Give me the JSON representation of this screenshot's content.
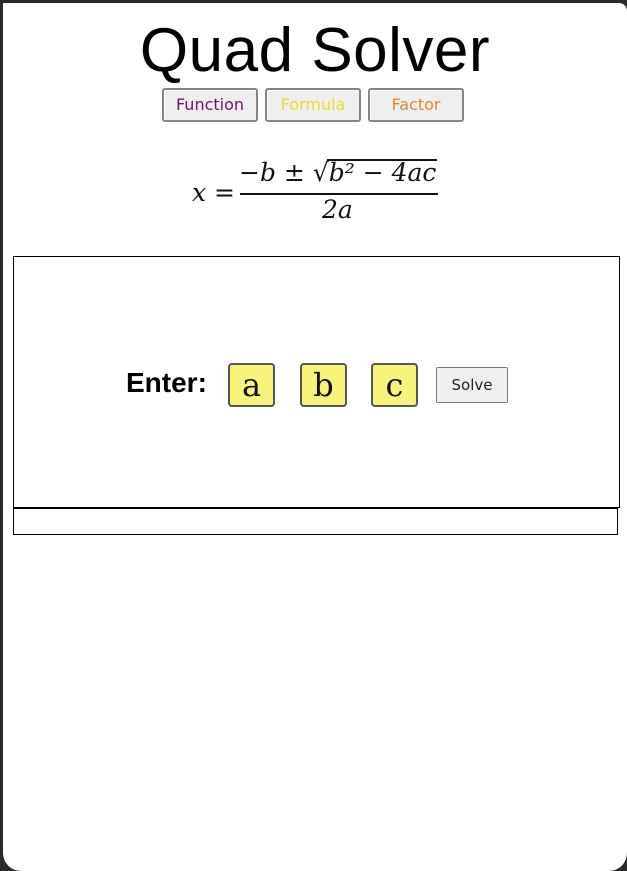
{
  "app": {
    "title": "Quad Solver"
  },
  "tabs": [
    {
      "label": "Function",
      "color": "#6a1670"
    },
    {
      "label": "Formula",
      "color": "#ecdc1d"
    },
    {
      "label": "Factor",
      "color": "#e08a2a"
    }
  ],
  "formula": {
    "lhs": "x",
    "equals": "=",
    "numerator": "−b ± √b² − 4ac",
    "denominator": "2a"
  },
  "solver": {
    "enter_label": "Enter:",
    "coefficients": [
      {
        "placeholder": "a"
      },
      {
        "placeholder": "b"
      },
      {
        "placeholder": "c"
      }
    ],
    "input_color": "#f8f47a",
    "solve_label": "Solve"
  },
  "result": {
    "text": ""
  }
}
